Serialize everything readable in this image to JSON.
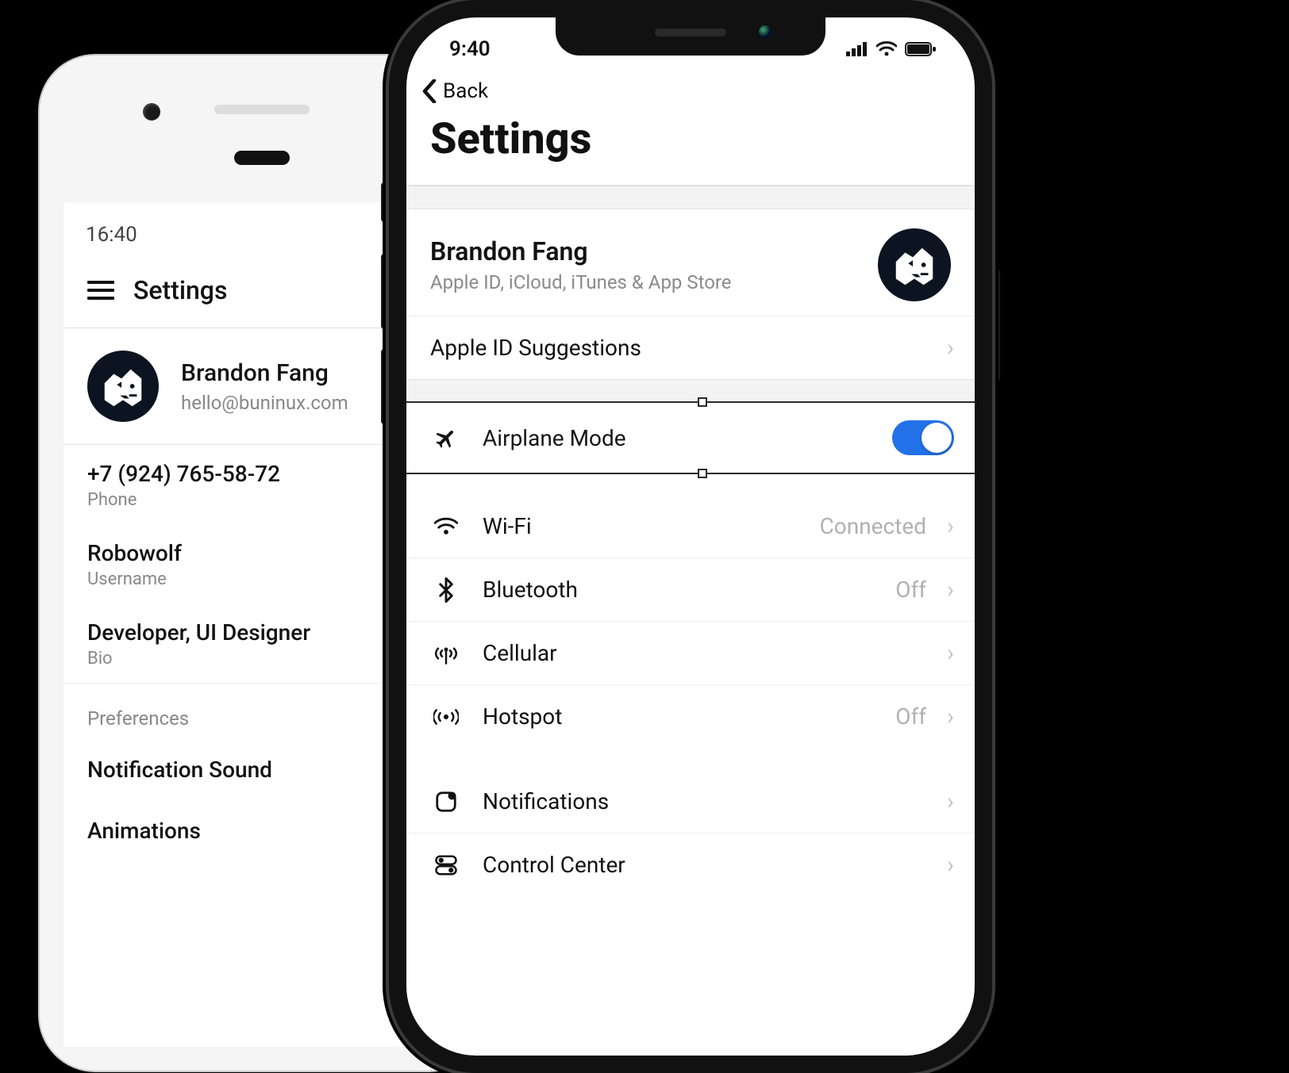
{
  "android": {
    "time": "16:40",
    "header_title": "Settings",
    "profile": {
      "name": "Brandon Fang",
      "email": "hello@buninux.com"
    },
    "info": [
      {
        "value": "+7 (924) 765-58-72",
        "label": "Phone"
      },
      {
        "value": "Robowolf",
        "label": "Username"
      },
      {
        "value": "Developer, UI Designer",
        "label": "Bio"
      }
    ],
    "preferences": {
      "section": "Preferences",
      "items": [
        "Notification Sound",
        "Animations"
      ]
    }
  },
  "ios": {
    "time": "9:40",
    "back_label": "Back",
    "title": "Settings",
    "profile": {
      "name": "Brandon Fang",
      "subtitle": "Apple ID, iCloud, iTunes & App Store"
    },
    "suggestions_label": "Apple ID Suggestions",
    "rows": {
      "airplane": {
        "label": "Airplane Mode",
        "on": true
      },
      "wifi": {
        "label": "Wi-Fi",
        "value": "Connected"
      },
      "bluetooth": {
        "label": "Bluetooth",
        "value": "Off"
      },
      "cellular": {
        "label": "Cellular",
        "value": ""
      },
      "hotspot": {
        "label": "Hotspot",
        "value": "Off"
      },
      "notifications": {
        "label": "Notifications",
        "value": ""
      },
      "control_center": {
        "label": "Control Center",
        "value": ""
      }
    }
  }
}
